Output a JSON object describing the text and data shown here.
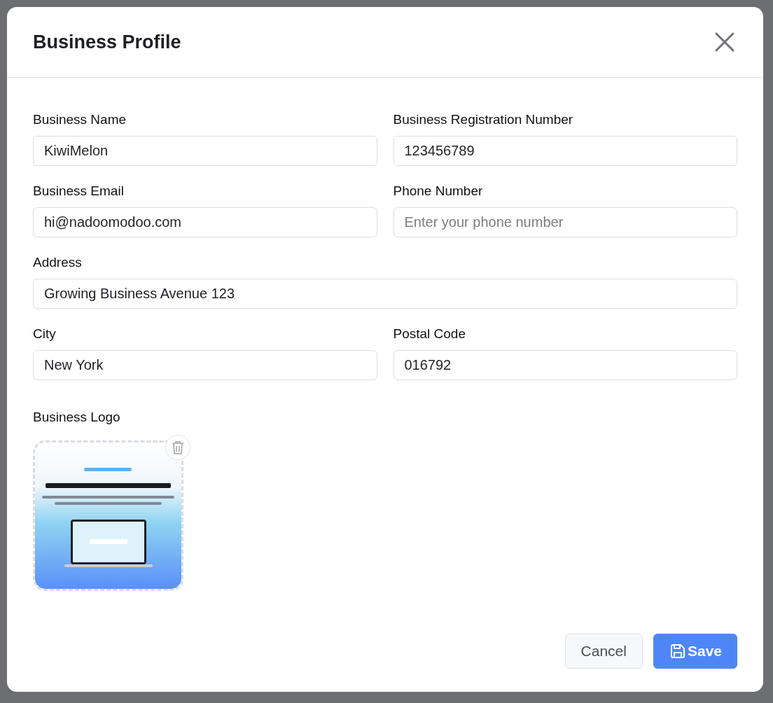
{
  "dialog": {
    "title": "Business Profile",
    "rows": [
      [
        {
          "label": "Business Name",
          "value": "KiwiMelon"
        },
        {
          "label": "Business Registration Number",
          "value": "123456789"
        }
      ],
      [
        {
          "label": "Business Email",
          "value": "hi@nadoomodoo.com"
        },
        {
          "label": "Phone Number",
          "placeholder": "Enter your phone number"
        }
      ],
      [
        {
          "label": "Address",
          "value": "Growing Business Avenue 123"
        }
      ],
      [
        {
          "label": "City",
          "value": "New York"
        },
        {
          "label": "Postal Code",
          "value": "016792"
        }
      ]
    ],
    "logo": {
      "label": "Business Logo"
    },
    "buttons": [
      {
        "label": "Cancel",
        "kind": "secondary"
      },
      {
        "label": "Save",
        "kind": "primary"
      }
    ]
  }
}
